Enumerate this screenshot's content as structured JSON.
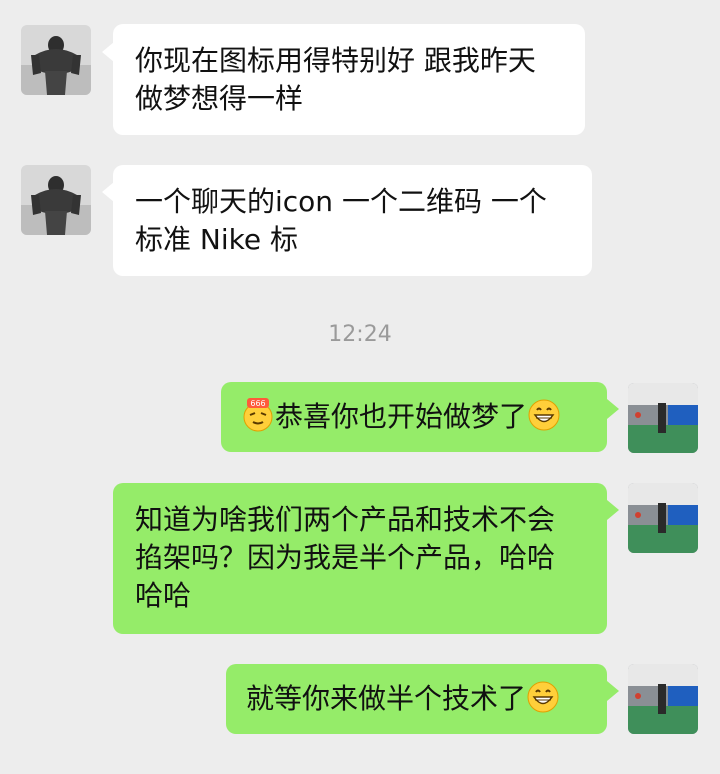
{
  "messages": [
    {
      "side": "in",
      "text": "你现在图标用得特别好 跟我昨天做梦想得一样",
      "lines": [
        "你现在图标用得特别好 跟我昨天",
        "做梦想得一样"
      ]
    },
    {
      "side": "in",
      "text": "一个聊天的icon 一个二维码 一个标准Nike标",
      "lines": [
        "一个聊天的icon 一个二维码 一个",
        "标准 Nike 标"
      ]
    },
    {
      "side": "out",
      "text": "恭喜你也开始做梦了",
      "lead_icon": "666-face-emoji",
      "trail_icon": "grin-emoji"
    },
    {
      "side": "out",
      "lines": [
        "知道为啥我们两个产品和技术不会",
        "掐架吗？因为我是半个产品，哈哈",
        "哈哈"
      ]
    },
    {
      "side": "out",
      "text": "就等你来做半个技术了",
      "trail_icon": "grin-emoji"
    }
  ],
  "timestamp": "12:24",
  "emoji_badge": "666",
  "colors": {
    "background": "#ededed",
    "incoming_bubble": "#ffffff",
    "outgoing_bubble": "#95ec69",
    "timestamp": "#9a9a9a"
  },
  "avatars": {
    "incoming": "muscle-man-avatar",
    "outgoing": "gym-court-avatar"
  }
}
